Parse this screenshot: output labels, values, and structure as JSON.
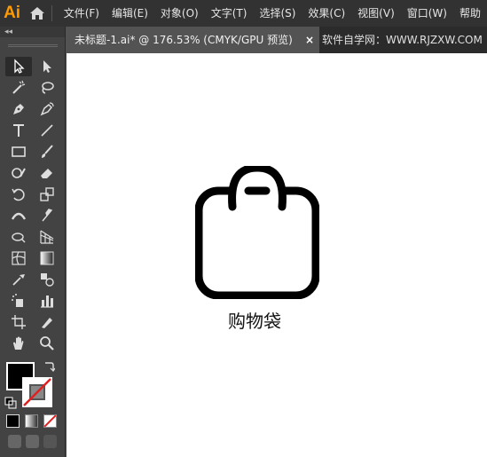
{
  "app": {
    "logo": "Ai"
  },
  "menu": [
    "文件(F)",
    "编辑(E)",
    "对象(O)",
    "文字(T)",
    "选择(S)",
    "效果(C)",
    "视图(V)",
    "窗口(W)",
    "帮助"
  ],
  "tabs": {
    "active": "未标题-1.ai* @ 176.53% (CMYK/GPU 预览)",
    "close": "×",
    "second": "软件自学网：WWW.RJZXW.COM"
  },
  "toolbar": {
    "collapse": "◂◂"
  },
  "canvas": {
    "caption": "购物袋"
  },
  "colors": {
    "menubar": "#323232",
    "toolbar": "#434343",
    "logo": "#ff9a00",
    "canvas": "#ffffff"
  }
}
